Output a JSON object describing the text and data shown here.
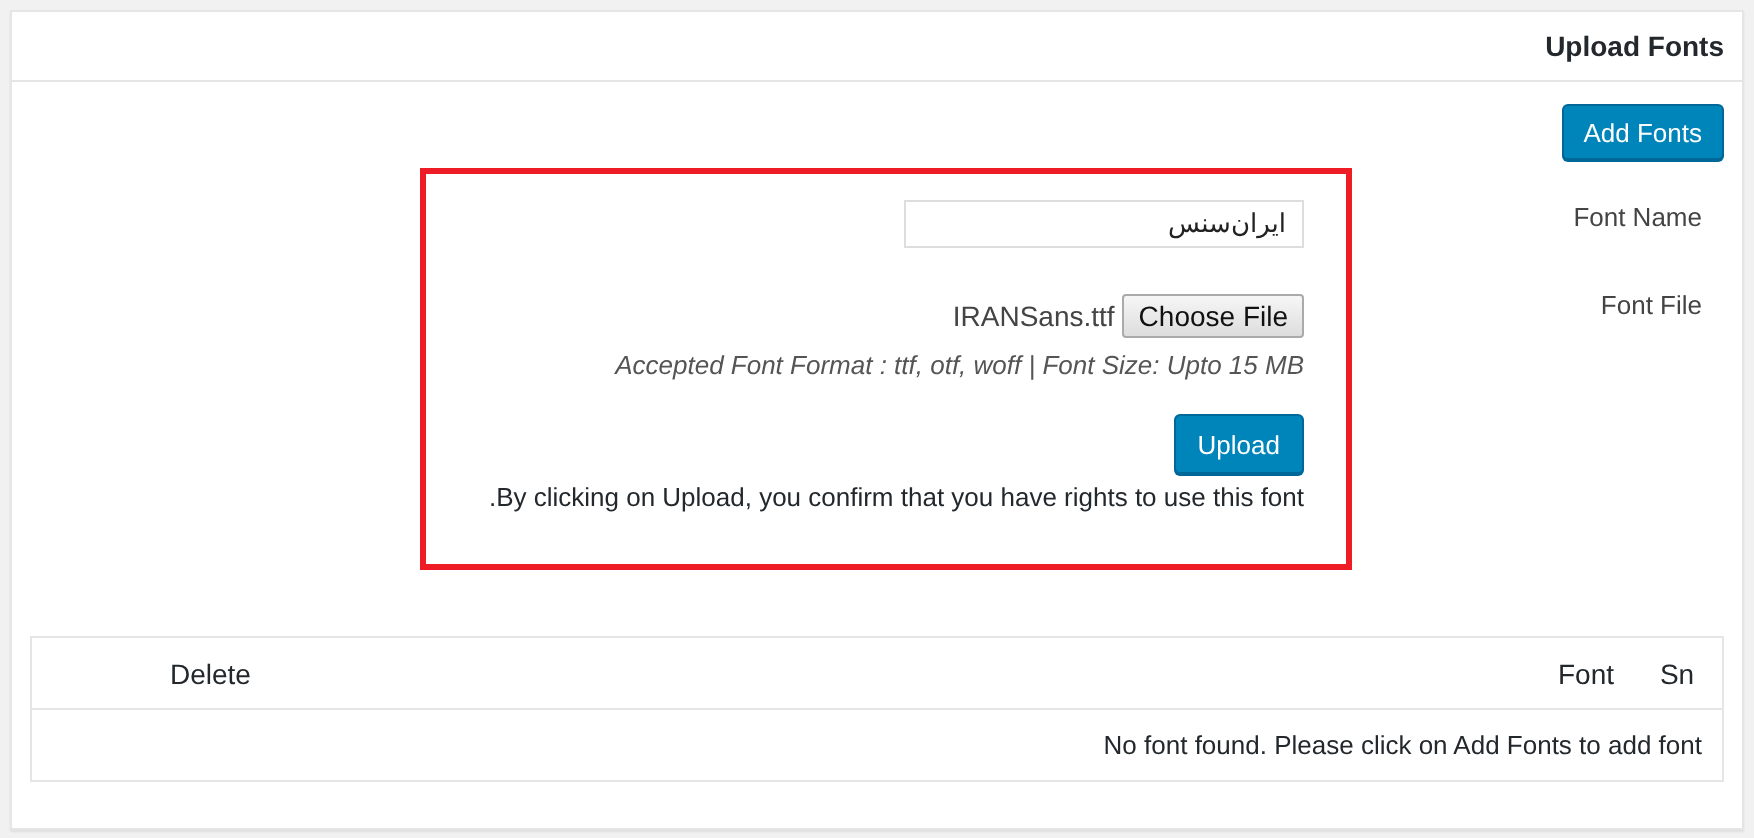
{
  "panel": {
    "title": "Upload Fonts"
  },
  "add_button": "Add Fonts",
  "form": {
    "fields": [
      {
        "label": "Font Name",
        "kind": "text",
        "value": "ایران‌سنس"
      },
      {
        "label": "Font File",
        "kind": "file",
        "filename": "IRANSans.ttf",
        "button": "Choose File",
        "hint": "Accepted Font Format : ttf, otf, woff | Font Size: Upto 15 MB"
      }
    ],
    "submit": "Upload",
    "notice": ".By clicking on Upload, you confirm that you have rights to use this font"
  },
  "table": {
    "columns": [
      "Delete",
      "Font",
      "Sn"
    ],
    "empty_message": "No font found. Please click on Add Fonts to add font"
  }
}
